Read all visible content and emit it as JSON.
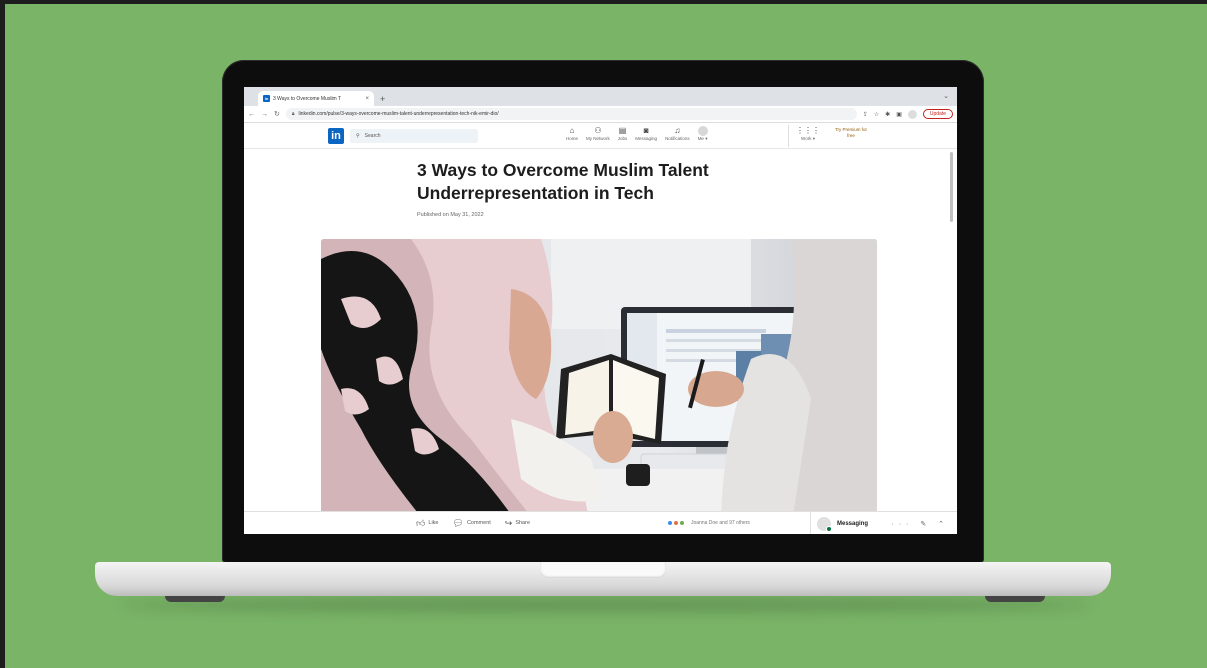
{
  "browser": {
    "tab_title": "3 Ways to Overcome Muslim T",
    "tab_close": "×",
    "new_tab": "+",
    "url": "linkedin.com/pulse/3-ways-overcome-muslim-talent-underrepresentation-tech-nik-emir-dio/",
    "update_label": "Update",
    "tab_dropdown": "⌄"
  },
  "linkedin": {
    "logo": "in",
    "search_placeholder": "Search",
    "nav": [
      {
        "label": "Home",
        "icon": "home-icon"
      },
      {
        "label": "My Network",
        "icon": "network-icon"
      },
      {
        "label": "Jobs",
        "icon": "jobs-icon"
      },
      {
        "label": "Messaging",
        "icon": "messaging-icon"
      },
      {
        "label": "Notifications",
        "icon": "bell-icon"
      },
      {
        "label": "Me ▾",
        "icon": "avatar"
      }
    ],
    "work_label": "Work ▾",
    "premium_line1": "Try Premium for",
    "premium_line2": "free"
  },
  "article": {
    "title_line1": "3 Ways to Overcome Muslim Talent",
    "title_line2": "Underrepresentation in Tech",
    "published": "Published on May 31, 2022"
  },
  "actions": {
    "like": "Like",
    "comment": "Comment",
    "share": "Share",
    "reactions_text": "Joanna Doe and 97 others"
  },
  "messaging": {
    "label": "Messaging",
    "controls": "··· ✎ ⌃"
  },
  "colors": {
    "background": "#79b467",
    "linkedin_blue": "#0a66c2"
  }
}
